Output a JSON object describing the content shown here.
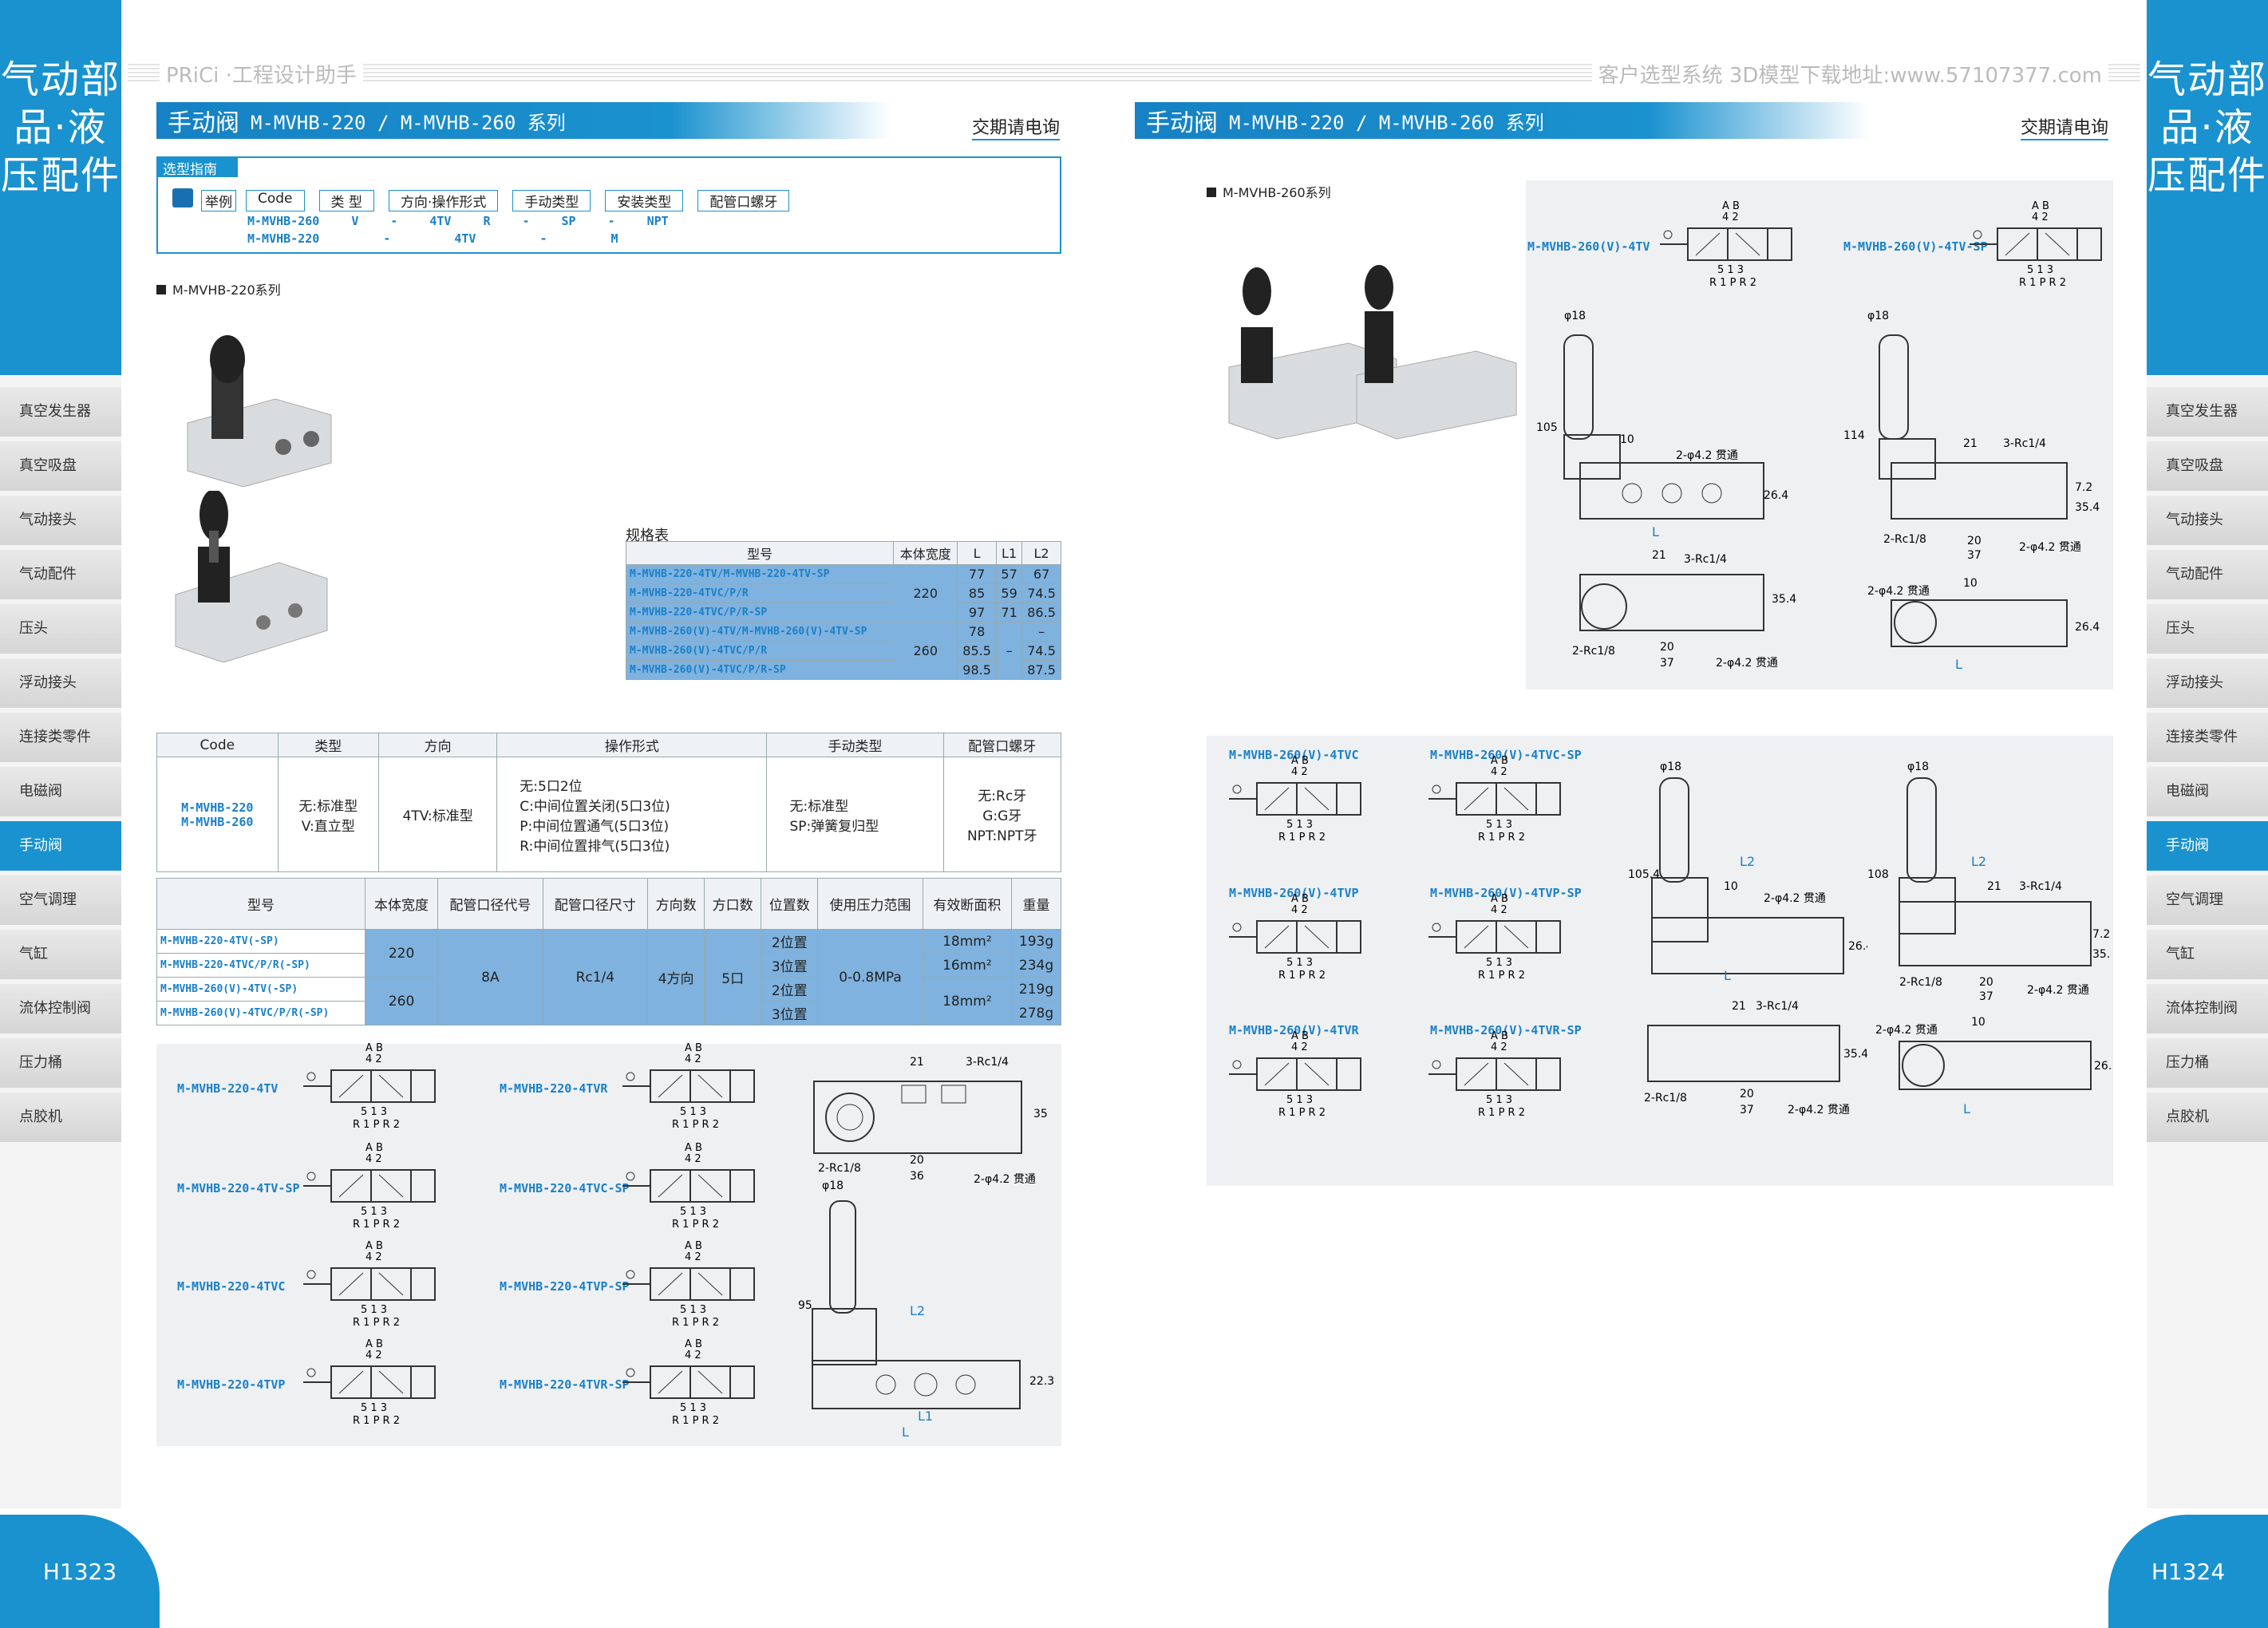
{
  "header": {
    "left": "PRiCi ·工程设计助手",
    "right": "客户选型系统 3D模型下载地址:www.57107377.com"
  },
  "side": {
    "title": "气动部品·液压配件",
    "tabs": [
      "真空发生器",
      "真空吸盘",
      "气动接头",
      "气动配件",
      "压头",
      "浮动接头",
      "连接类零件",
      "电磁阀",
      "手动阀",
      "空气调理",
      "气缸",
      "流体控制阀",
      "压力桶",
      "点胶机"
    ]
  },
  "pages": {
    "left": "H1323",
    "right": "H1324"
  },
  "title": {
    "main": "手动阀",
    "series": "M-MVHB-220 / M-MVHB-260 系列"
  },
  "contact": "交期请电询",
  "guide": {
    "title": "选型指南",
    "example": "举例",
    "heads": [
      "Code",
      "类 型",
      "方向·操作形式",
      "手动类型",
      "安装类型",
      "配管口螺牙"
    ],
    "row1": [
      "M-MVHB-260",
      "V",
      "-",
      "4TV",
      "R",
      "-",
      "SP",
      "-",
      "NPT"
    ],
    "row2": [
      "M-MVHB-220",
      "-",
      "4TV",
      "-",
      "M"
    ]
  },
  "sec220": "M-MVHB-220系列",
  "sec260": "M-MVHB-260系列",
  "spec": {
    "title": "规格表",
    "heads": [
      "型号",
      "本体宽度",
      "L",
      "L1",
      "L2"
    ],
    "rows": [
      [
        "M-MVHB-220-4TV/M-MVHB-220-4TV-SP",
        "220",
        "77",
        "57",
        "67"
      ],
      [
        "M-MVHB-220-4TVC/P/R",
        "",
        "85",
        "59",
        "74.5"
      ],
      [
        "M-MVHB-220-4TVC/P/R-SP",
        "",
        "97",
        "71",
        "86.5"
      ],
      [
        "M-MVHB-260(V)-4TV/M-MVHB-260(V)-4TV-SP",
        "260",
        "78",
        "–",
        "–"
      ],
      [
        "M-MVHB-260(V)-4TVC/P/R",
        "",
        "85.5",
        "",
        "74.5"
      ],
      [
        "M-MVHB-260(V)-4TVC/P/R-SP",
        "",
        "98.5",
        "",
        "87.5"
      ]
    ]
  },
  "codetable": {
    "heads": [
      "Code",
      "类型",
      "方向",
      "操作形式",
      "手动类型",
      "配管口螺牙"
    ],
    "code": [
      "M-MVHB-220",
      "M-MVHB-260"
    ],
    "type": [
      "无:标准型",
      "V:直立型"
    ],
    "dir": "4TV:标准型",
    "op": [
      "无:5口2位",
      "C:中间位置关闭(5口3位)",
      "P:中间位置通气(5口3位)",
      "R:中间位置排气(5口3位)"
    ],
    "manual": [
      "无:标准型",
      "SP:弹簧复归型"
    ],
    "thread": [
      "无:Rc牙",
      "G:G牙",
      "NPT:NPT牙"
    ]
  },
  "perf": {
    "heads": [
      "型号",
      "本体宽度",
      "配管口径代号",
      "配管口径尺寸",
      "方向数",
      "方口数",
      "位置数",
      "使用压力范围",
      "有效断面积",
      "重量"
    ],
    "models": [
      "M-MVHB-220-4TV(-SP)",
      "M-MVHB-220-4TVC/P/R(-SP)",
      "M-MVHB-260(V)-4TV(-SP)",
      "M-MVHB-260(V)-4TVC/P/R(-SP)"
    ],
    "width": [
      "220",
      "260"
    ],
    "code": "8A",
    "size": "Rc1/4",
    "dirs": "4方向",
    "ports": "5口",
    "pos": [
      "2位置",
      "3位置",
      "2位置",
      "3位置"
    ],
    "press": "0-0.8MPa",
    "area": [
      "18mm²",
      "16mm²",
      "18mm²"
    ],
    "weight": [
      "193g",
      "234g",
      "219g",
      "278g"
    ]
  },
  "sym220": [
    "M-MVHB-220-4TV",
    "M-MVHB-220-4TV-SP",
    "M-MVHB-220-4TVC",
    "M-MVHB-220-4TVP",
    "M-MVHB-220-4TVR",
    "M-MVHB-220-4TVC-SP",
    "M-MVHB-220-4TVP-SP",
    "M-MVHB-220-4TVR-SP"
  ],
  "sym260": [
    "M-MVHB-260(V)-4TVC",
    "M-MVHB-260(V)-4TVP",
    "M-MVHB-260(V)-4TVR",
    "M-MVHB-260(V)-4TVC-SP",
    "M-MVHB-260(V)-4TVP-SP",
    "M-MVHB-260(V)-4TVR-SP"
  ],
  "sym260top": [
    "M-MVHB-260(V)-4TV",
    "M-MVHB-260(V)-4TV-SP"
  ],
  "ports": {
    "top": "A B",
    "top2": "4 2",
    "bot": "5 1 3",
    "bot2": "R 1 P R 2"
  },
  "dims": {
    "d18": "φ18",
    "h105": "105",
    "h114": "114",
    "h1054": "105.4",
    "h108": "108",
    "h95": "95",
    "w10": "10",
    "w21": "21",
    "w20": "20",
    "w36": "36",
    "w37": "37",
    "rc14": "3-Rc1/4",
    "rc18": "2-Rc1/8",
    "hole": "2-φ4.2 贯通",
    "v35": "35",
    "v354": "35.4",
    "v72": "7.2",
    "v264": "26.4",
    "v223": "22.3",
    "L": "L",
    "L1": "L1",
    "L2": "L2"
  }
}
